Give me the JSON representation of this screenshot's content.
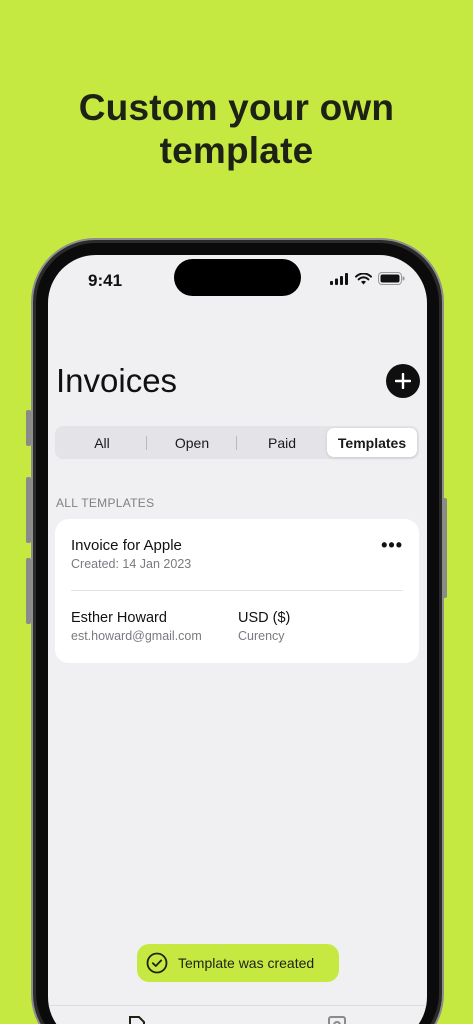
{
  "headline": {
    "line1": "Custom your own",
    "line2": "template"
  },
  "status_bar": {
    "time": "9:41",
    "icons": [
      "signal-icon",
      "wifi-icon",
      "battery-icon"
    ]
  },
  "page": {
    "title": "Invoices",
    "add_icon": "plus-icon"
  },
  "tabs": [
    {
      "label": "All",
      "active": false
    },
    {
      "label": "Open",
      "active": false
    },
    {
      "label": "Paid",
      "active": false
    },
    {
      "label": "Templates",
      "active": true
    }
  ],
  "section_label": "ALL TEMPLATES",
  "template_card": {
    "title": "Invoice for Apple",
    "created": "Created: 14 Jan 2023",
    "more_label": "•••",
    "client_name": "Esther Howard",
    "client_email": "est.howard@gmail.com",
    "currency": "USD ($)",
    "currency_label": "Curency"
  },
  "toast": {
    "text": "Template was created",
    "icon": "check-circle-icon"
  },
  "tab_bar": {
    "icons": [
      "invoices-tab-icon",
      "profile-tab-icon"
    ]
  },
  "colors": {
    "accent": "#c6e942",
    "text": "#1d2215",
    "screen_bg": "#f0f0f2"
  }
}
